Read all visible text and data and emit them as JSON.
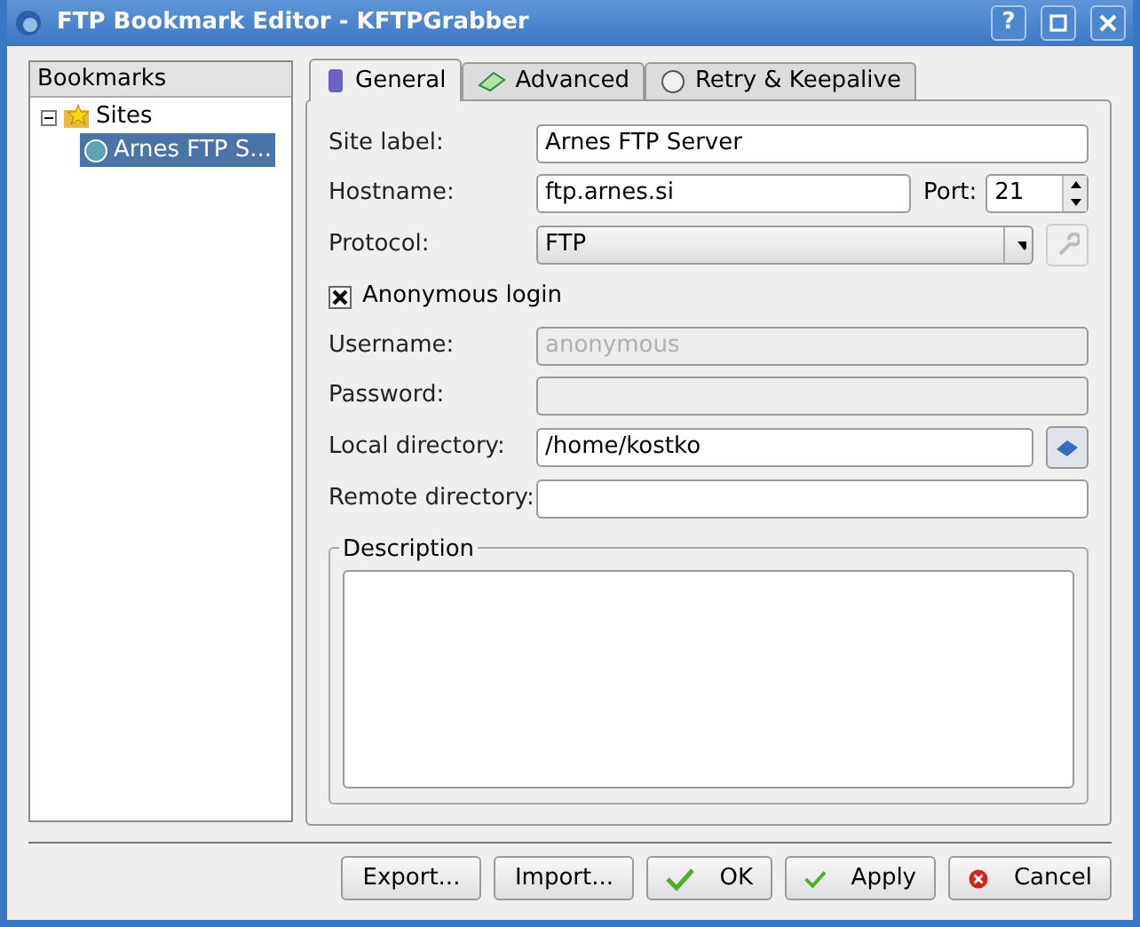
{
  "window": {
    "title": "FTP Bookmark Editor - KFTPGrabber"
  },
  "title_buttons": [
    {
      "kind": "help",
      "label": "?"
    },
    {
      "kind": "maximize"
    },
    {
      "kind": "close"
    }
  ],
  "bookmarks": {
    "header": "Bookmarks",
    "items": [
      {
        "label": "Sites",
        "expanded": true,
        "selected": false,
        "children": [
          {
            "label": "Arnes FTP S...",
            "selected": true
          }
        ]
      }
    ]
  },
  "tabs": [
    {
      "label": "General",
      "selected": true
    },
    {
      "label": "Advanced",
      "selected": false
    },
    {
      "label": "Retry & Keepalive",
      "selected": false
    }
  ],
  "form": {
    "site_label": {
      "label": "Site label:",
      "value": "Arnes FTP Server"
    },
    "hostname": {
      "label": "Hostname:",
      "value": "ftp.arnes.si"
    },
    "port": {
      "label": "Port:",
      "value": "21"
    },
    "protocol": {
      "label": "Protocol:",
      "value": "FTP"
    },
    "anonymous": {
      "label": "Anonymous login",
      "checked": true
    },
    "username": {
      "label": "Username:",
      "value": "anonymous",
      "disabled": true
    },
    "password": {
      "label": "Password:",
      "disabled": true
    },
    "local_directory": {
      "label": "Local directory:",
      "value": "/home/kostko"
    },
    "remote_directory": {
      "label": "Remote directory:"
    },
    "description": {
      "label": "Description"
    }
  },
  "buttons": [
    {
      "label": "Export...",
      "kind": "plain"
    },
    {
      "label": "Import...",
      "kind": "plain"
    },
    {
      "label": "OK",
      "kind": "confirm"
    },
    {
      "label": "Apply",
      "kind": "confirm"
    },
    {
      "label": "Cancel",
      "kind": "cancel"
    }
  ]
}
